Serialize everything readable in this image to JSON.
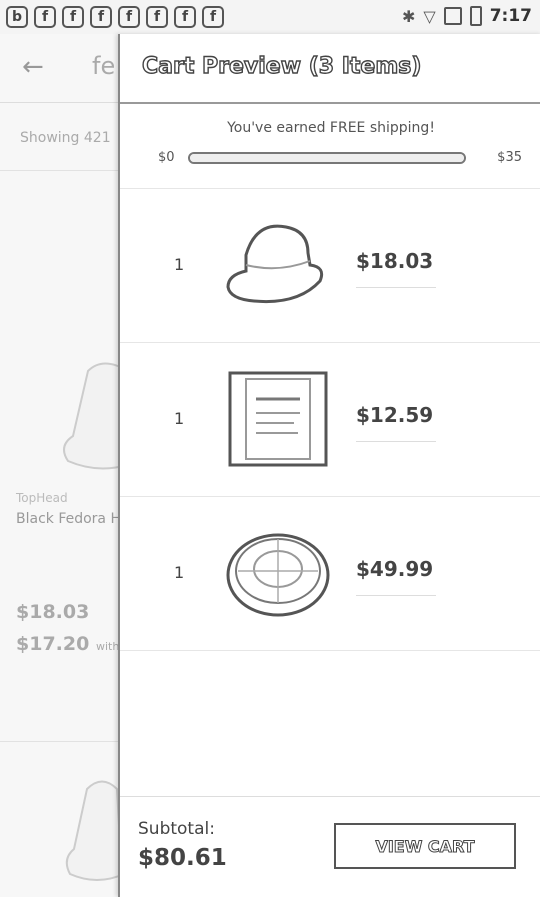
{
  "status_bar": {
    "left_icons": [
      "b",
      "f",
      "f",
      "f",
      "f",
      "f",
      "f",
      "f"
    ],
    "time": "7:17"
  },
  "background_page": {
    "back_icon": "arrow-left-icon",
    "search_text": "fe",
    "showing_text": "Showing 421",
    "product": {
      "brand": "TopHead",
      "name": "Black Fedora H",
      "price": "$18.03",
      "alt_price": "$17.20",
      "alt_price_suffix": "with"
    }
  },
  "cart_preview": {
    "title": "Cart Preview (3 Items)",
    "shipping": {
      "message": "You've earned FREE shipping!",
      "min_label": "$0",
      "max_label": "$35",
      "progress": 1.0
    },
    "items": [
      {
        "qty": "1",
        "image_icon": "fedora-hat-icon",
        "price": "$18.03"
      },
      {
        "qty": "1",
        "image_icon": "product-box-icon",
        "price": "$12.59"
      },
      {
        "qty": "1",
        "image_icon": "cake-icon",
        "price": "$49.99"
      }
    ],
    "subtotal_label": "Subtotal:",
    "subtotal_value": "$80.61",
    "view_cart_label": "VIEW CART"
  }
}
